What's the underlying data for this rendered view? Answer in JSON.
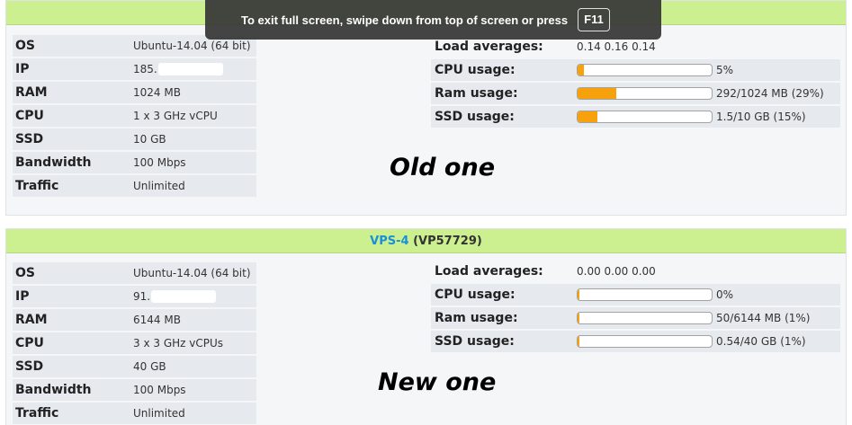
{
  "fullscreen_toast": {
    "message": "To exit full screen, swipe down from top of screen or press",
    "key": "F11"
  },
  "annotations": {
    "old": "Old one",
    "new": "New one"
  },
  "vps_old": {
    "header": {
      "name": "",
      "code": ""
    },
    "specs": [
      {
        "key": "OS",
        "value": "Ubuntu-14.04 (64 bit)"
      },
      {
        "key": "IP",
        "value": "185."
      },
      {
        "key": "RAM",
        "value": "1024 MB"
      },
      {
        "key": "CPU",
        "value": "1 x 3 GHz vCPU"
      },
      {
        "key": "SSD",
        "value": "10 GB"
      },
      {
        "key": "Bandwidth",
        "value": "100 Mbps"
      },
      {
        "key": "Traffic",
        "value": "Unlimited"
      }
    ],
    "load_averages": {
      "label": "Load averages:",
      "value": "0.14 0.16 0.14"
    },
    "usage": [
      {
        "label": "CPU usage:",
        "value": "5%",
        "fraction": 0.05
      },
      {
        "label": "Ram usage:",
        "value": "292/1024 MB (29%)",
        "fraction": 0.29
      },
      {
        "label": "SSD usage:",
        "value": "1.5/10 GB (15%)",
        "fraction": 0.15
      }
    ]
  },
  "vps_new": {
    "header": {
      "name": "VPS-4",
      "code": "(VP57729)"
    },
    "specs": [
      {
        "key": "OS",
        "value": "Ubuntu-14.04 (64 bit)"
      },
      {
        "key": "IP",
        "value": "91."
      },
      {
        "key": "RAM",
        "value": "6144 MB"
      },
      {
        "key": "CPU",
        "value": "3 x 3 GHz vCPUs"
      },
      {
        "key": "SSD",
        "value": "40 GB"
      },
      {
        "key": "Bandwidth",
        "value": "100 Mbps"
      },
      {
        "key": "Traffic",
        "value": "Unlimited"
      }
    ],
    "load_averages": {
      "label": "Load averages:",
      "value": "0.00 0.00 0.00"
    },
    "usage": [
      {
        "label": "CPU usage:",
        "value": "0%",
        "fraction": 0.0
      },
      {
        "label": "Ram usage:",
        "value": "50/6144 MB (1%)",
        "fraction": 0.01
      },
      {
        "label": "SSD usage:",
        "value": "0.54/40 GB (1%)",
        "fraction": 0.01
      }
    ]
  }
}
